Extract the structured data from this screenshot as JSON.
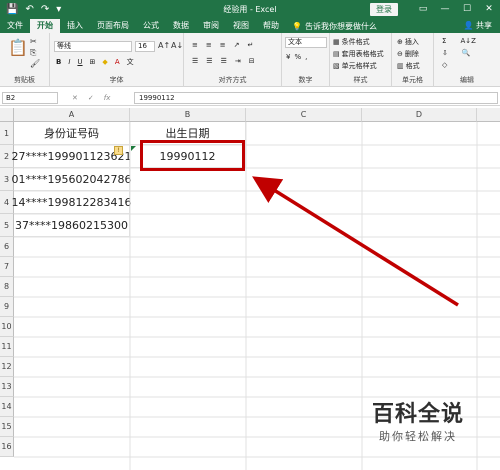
{
  "app": {
    "title": "经验用 - Excel",
    "login_label": "登录",
    "share_label": "共享",
    "tell_me": "告诉我你想要做什么"
  },
  "tabs": [
    "文件",
    "开始",
    "插入",
    "页面布局",
    "公式",
    "数据",
    "审阅",
    "视图",
    "帮助"
  ],
  "active_tab": "开始",
  "ribbon": {
    "clipboard": "剪贴板",
    "font_group": "字体",
    "font_name": "等线",
    "font_size": "16",
    "align_group": "对齐方式",
    "number_group": "数字",
    "number_format": "文本",
    "styles_group": "样式",
    "cond_format": "条件格式",
    "table_format": "套用表格格式",
    "cell_style": "单元格样式",
    "cells_group": "单元格",
    "insert": "插入",
    "delete": "删除",
    "format": "格式",
    "edit_group": "编辑"
  },
  "formula_bar": {
    "name_box": "B2",
    "value": "19990112"
  },
  "columns": [
    "A",
    "B",
    "C",
    "D"
  ],
  "rows": [
    "1",
    "2",
    "3",
    "4",
    "5",
    "6",
    "7",
    "8",
    "9",
    "10",
    "11",
    "12",
    "13",
    "14",
    "15",
    "16"
  ],
  "cells": {
    "A1": "身份证号码",
    "B1": "出生日期",
    "A2": "27****199901123621",
    "B2": "19990112",
    "A3": "01****195602042786",
    "A4": "14****199812283416",
    "A5": "37****19860215300"
  },
  "watermark": {
    "main": "百科全说",
    "sub": "助你轻松解决"
  },
  "colors": {
    "excel_green": "#217346",
    "highlight_red": "#c00000"
  }
}
